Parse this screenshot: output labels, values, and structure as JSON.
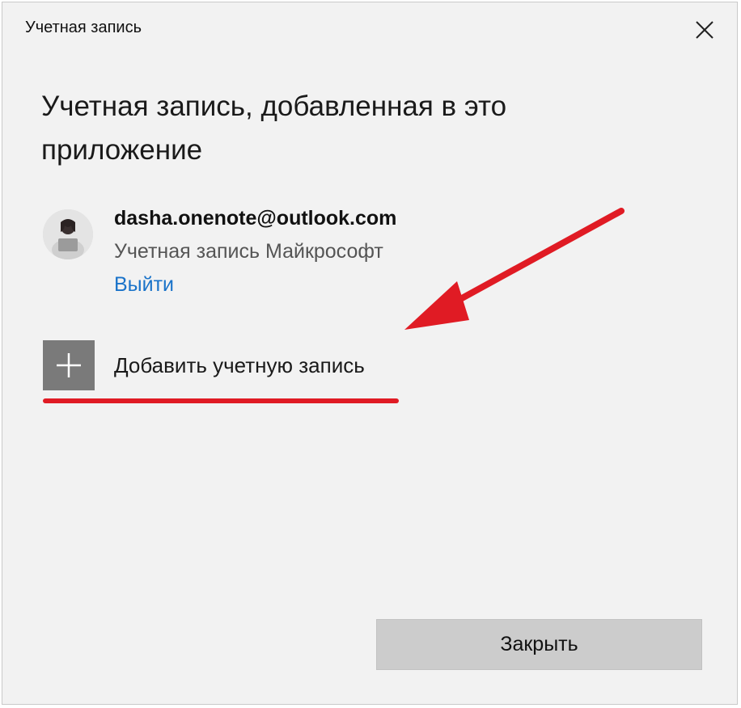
{
  "window": {
    "title": "Учетная запись",
    "close_icon": "close-icon"
  },
  "heading": "Учетная запись, добавленная в это приложение",
  "account": {
    "email": "dasha.onenote@outlook.com",
    "type": "Учетная запись Майкрософт",
    "sign_out_label": "Выйти",
    "avatar_icon": "user-avatar"
  },
  "add_account": {
    "label": "Добавить учетную запись",
    "icon": "plus-icon"
  },
  "footer": {
    "close_label": "Закрыть"
  },
  "colors": {
    "background": "#f2f2f2",
    "link": "#1a73c9",
    "tile": "#7a7a7a",
    "annotation": "#e01b24",
    "button": "#cccccc"
  }
}
